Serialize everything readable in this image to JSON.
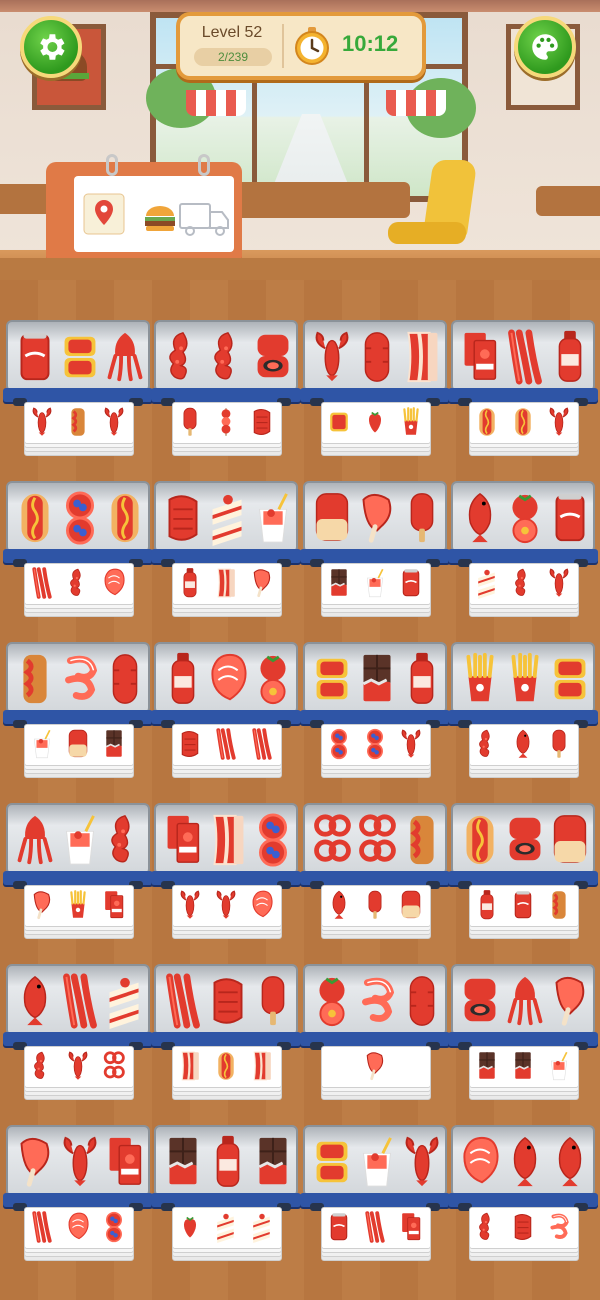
{
  "hud": {
    "level_label": "Level 52",
    "level_progress_text": "2/239",
    "level_progress": 0.0084,
    "timer": "10:12",
    "settings_icon": "gear-icon",
    "palette_icon": "palette-icon",
    "timer_icon": "stopwatch-icon"
  },
  "calendar": {
    "icon_map": "map-pin-icon",
    "icon_burger": "burger-icon",
    "icon_truck": "delivery-truck-icon"
  },
  "colors": {
    "accent_green": "#37a93a",
    "hud_border": "#e39a3b",
    "rail_blue": "#2f55a6"
  },
  "shelves": [
    {
      "top": [
        "cola-can",
        "meat-tray",
        "squid"
      ],
      "next": [
        "lobster",
        "roll",
        "lobster"
      ]
    },
    {
      "top": [
        "octopus",
        "octopus",
        "sushi-roll"
      ],
      "next": [
        "popsicle",
        "kebab",
        "steak"
      ]
    },
    {
      "top": [
        "lobster",
        "sausage",
        "bacon"
      ],
      "next": [
        "tray",
        "strawberry",
        "fries"
      ]
    },
    {
      "top": [
        "ketchup",
        "crab-legs",
        "sauce-bottle"
      ],
      "next": [
        "hotdog",
        "hotdog",
        "lobster"
      ]
    },
    {
      "top": [
        "hotdog",
        "berry-tart",
        "hotdog"
      ],
      "next": [
        "crab-legs",
        "octopus",
        "salmon"
      ]
    },
    {
      "top": [
        "steak",
        "cake",
        "drink"
      ],
      "next": [
        "sauce-bottle",
        "bacon",
        "ham"
      ]
    },
    {
      "top": [
        "bread",
        "ham",
        "popsicle"
      ],
      "next": [
        "chocolate",
        "drink",
        "cola-can"
      ]
    },
    {
      "top": [
        "fish",
        "tomato",
        "cola-can"
      ],
      "next": [
        "cake",
        "octopus",
        "lobster"
      ]
    },
    {
      "top": [
        "roll",
        "shrimp",
        "sausage"
      ],
      "next": [
        "drink",
        "bread",
        "chocolate"
      ]
    },
    {
      "top": [
        "sauce-bottle",
        "salmon",
        "tomato"
      ],
      "next": [
        "steak",
        "crab-legs",
        "crab-legs"
      ]
    },
    {
      "top": [
        "meat-tray",
        "chocolate",
        "sauce-bottle"
      ],
      "next": [
        "berry-tart",
        "berry-tart",
        "lobster"
      ]
    },
    {
      "top": [
        "fries",
        "fries",
        "meat-tray"
      ],
      "next": [
        "octopus",
        "fish",
        "popsicle"
      ]
    },
    {
      "top": [
        "squid",
        "drink",
        "octopus"
      ],
      "next": [
        "ham",
        "fries",
        "ketchup"
      ]
    },
    {
      "top": [
        "ketchup",
        "bacon",
        "berry-tart"
      ],
      "next": [
        "lobster",
        "lobster",
        "salmon"
      ]
    },
    {
      "top": [
        "onion-rings",
        "onion-rings",
        "roll"
      ],
      "next": [
        "fish",
        "popsicle",
        "bread"
      ]
    },
    {
      "top": [
        "hotdog",
        "sushi-roll",
        "bread"
      ],
      "next": [
        "sauce-bottle",
        "cola-can",
        "roll"
      ]
    },
    {
      "top": [
        "fish",
        "crab-legs",
        "cake"
      ],
      "next": [
        "octopus",
        "lobster",
        "onion-rings"
      ]
    },
    {
      "top": [
        "crab-legs",
        "steak",
        "popsicle"
      ],
      "next": [
        "bacon",
        "hotdog",
        "bacon"
      ]
    },
    {
      "top": [
        "tomato",
        "shrimp",
        "sausage"
      ],
      "next": [
        "ham"
      ]
    },
    {
      "top": [
        "sushi-roll",
        "squid",
        "ham"
      ],
      "next": [
        "chocolate",
        "chocolate",
        "drink"
      ]
    },
    {
      "top": [
        "ham",
        "lobster",
        "ketchup"
      ],
      "next": [
        "crab-legs",
        "salmon",
        "berry-tart"
      ]
    },
    {
      "top": [
        "chocolate",
        "sauce-bottle",
        "chocolate"
      ],
      "next": [
        "strawberry",
        "cake",
        "cake"
      ]
    },
    {
      "top": [
        "meat-tray",
        "drink",
        "lobster"
      ],
      "next": [
        "cola-can",
        "crab-legs",
        "ketchup"
      ]
    },
    {
      "top": [
        "salmon",
        "fish",
        "fish"
      ],
      "next": [
        "octopus",
        "steak",
        "shrimp"
      ]
    }
  ]
}
